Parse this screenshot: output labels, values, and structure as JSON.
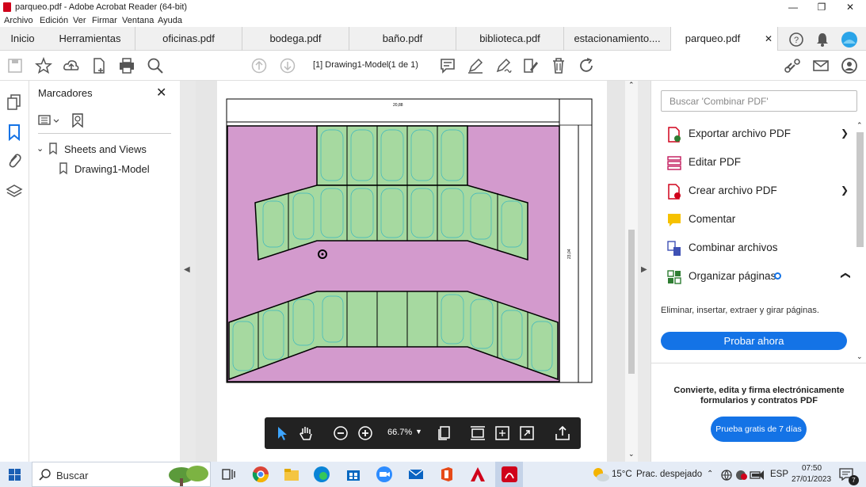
{
  "window": {
    "title": "parqueo.pdf - Adobe Acrobat Reader (64-bit)"
  },
  "menu": [
    "Archivo",
    "Edición",
    "Ver",
    "Firmar",
    "Ventana",
    "Ayuda"
  ],
  "tabs": {
    "home": "Inicio",
    "tools": "Herramientas",
    "files": [
      "oficinas.pdf",
      "bodega.pdf",
      "baño.pdf",
      "biblioteca.pdf",
      "estacionamiento....",
      "parqueo.pdf"
    ]
  },
  "toolbar": {
    "page_label": "[1] Drawing1-Model",
    "page_count": "(1 de 1)"
  },
  "bookmarks": {
    "title": "Marcadores",
    "root": "Sheets and Views",
    "child": "Drawing1-Model"
  },
  "drawing": {
    "dim_top": "20,88",
    "dim_right": "23,04",
    "colors": {
      "outer": "#d39acd",
      "stalls": "#a6d9a0",
      "lines": "#000000",
      "cars": "#3ab7bf"
    }
  },
  "right_pane": {
    "search_placeholder": "Buscar 'Combinar PDF'",
    "tools": [
      {
        "label": "Exportar archivo PDF",
        "icon": "export-pdf-icon",
        "expandable": true
      },
      {
        "label": "Editar PDF",
        "icon": "edit-pdf-icon",
        "expandable": false
      },
      {
        "label": "Crear archivo PDF",
        "icon": "create-pdf-icon",
        "expandable": true
      },
      {
        "label": "Comentar",
        "icon": "comment-icon",
        "expandable": false
      },
      {
        "label": "Combinar archivos",
        "icon": "combine-files-icon",
        "expandable": false
      },
      {
        "label": "Organizar páginas",
        "icon": "organize-pages-icon",
        "expandable": true
      }
    ],
    "organize_desc": "Eliminar, insertar, extraer y girar páginas.",
    "try_now": "Probar ahora",
    "promo_line1": "Convierte, edita y firma electrónicamente",
    "promo_line2": "formularios y contratos PDF",
    "trial_button": "Prueba gratis de 7 días",
    "accent": "#1473e6"
  },
  "floating_toolbar": {
    "zoom": "66.7%"
  },
  "taskbar": {
    "search": "Buscar",
    "weather": "15°C",
    "weather_desc": "Prac. despejado",
    "lang": "ESP",
    "time": "07:50",
    "date": "27/01/2023"
  }
}
